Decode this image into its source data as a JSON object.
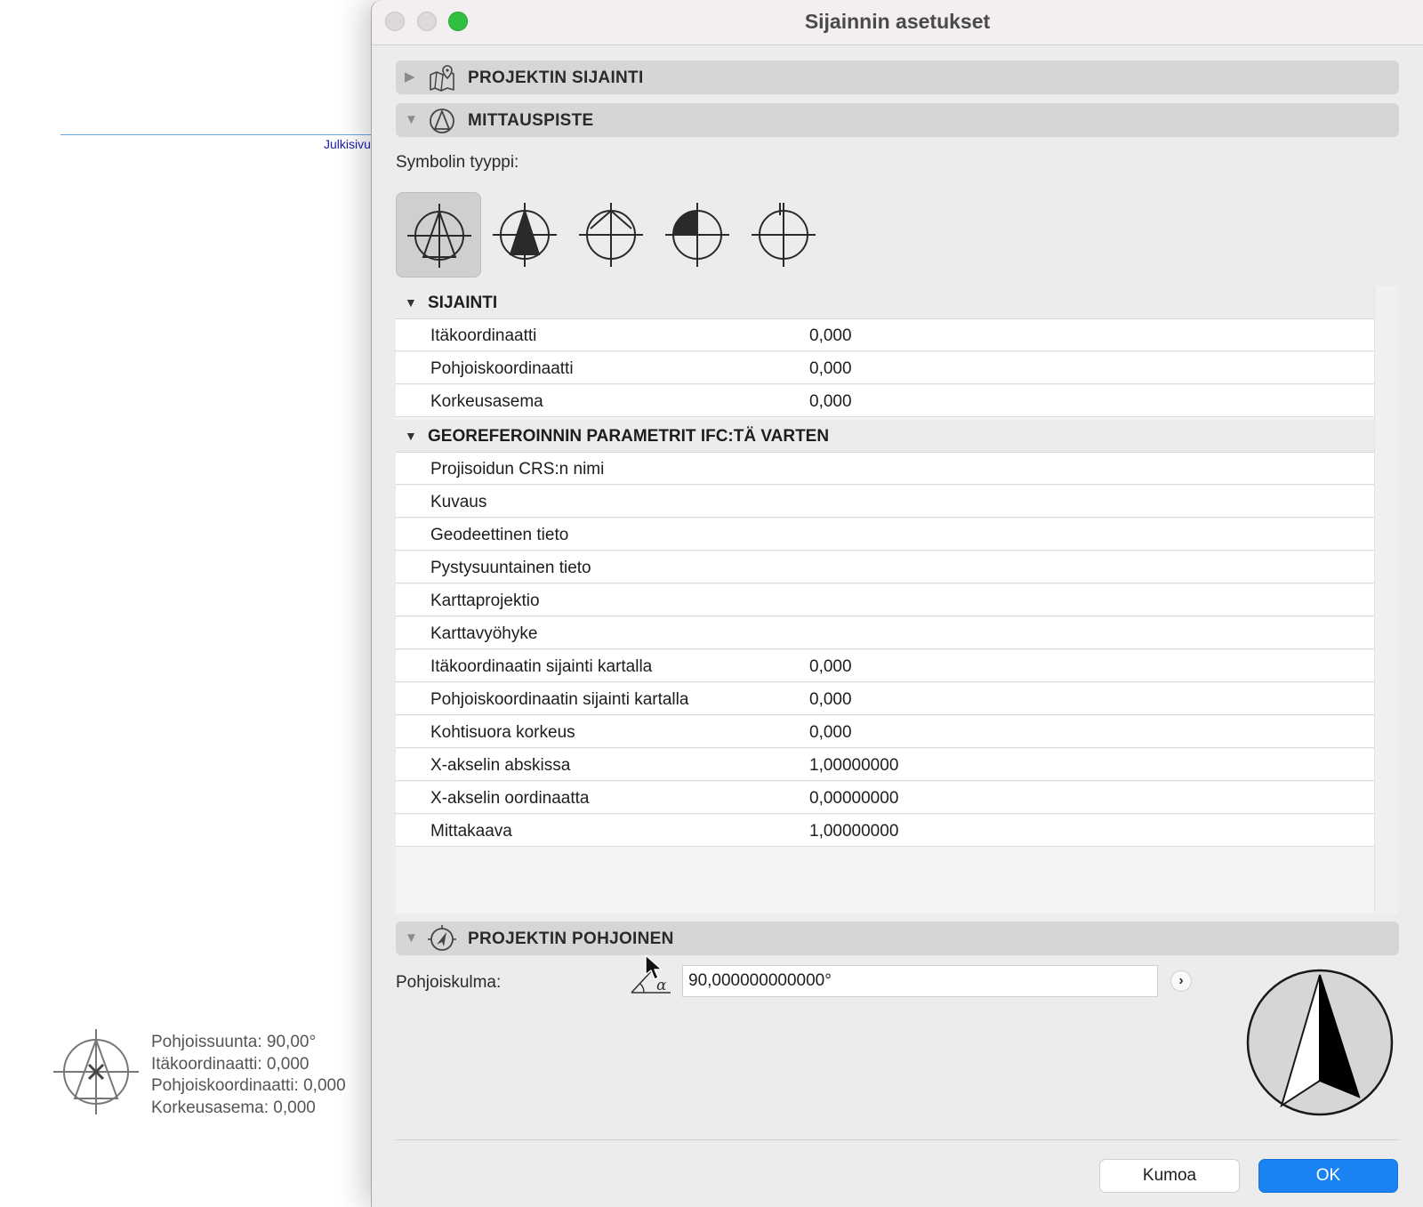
{
  "background": {
    "elevation_label": "Julkisivu",
    "survey_info": [
      "Pohjoissuunta: 90,00°",
      "Itäkoordinaatti: 0,000",
      "Pohjoiskoordinaatti: 0,000",
      "Korkeusasema: 0,000"
    ]
  },
  "dialog": {
    "title": "Sijainnin asetukset",
    "sections": {
      "project_location": {
        "label": "PROJEKTIN SIJAINTI",
        "expanded": false
      },
      "survey_point": {
        "label": "MITTAUSPISTE",
        "expanded": true
      },
      "project_north": {
        "label": "PROJEKTIN POHJOINEN",
        "expanded": true
      }
    },
    "symbol_type_label": "Symbolin tyyppi:",
    "symbol_types": [
      "symbol-type-1",
      "symbol-type-2",
      "symbol-type-3",
      "symbol-type-4",
      "symbol-type-5"
    ],
    "symbol_selected_index": 0,
    "location_group": {
      "label": "SIJAINTI",
      "rows": [
        {
          "key": "Itäkoordinaatti",
          "value": "0,000"
        },
        {
          "key": "Pohjoiskoordinaatti",
          "value": "0,000"
        },
        {
          "key": "Korkeusasema",
          "value": "0,000"
        }
      ]
    },
    "ifc_group": {
      "label": "GEOREFEROINNIN PARAMETRIT IFC:TÄ VARTEN",
      "rows": [
        {
          "key": "Projisoidun CRS:n nimi",
          "value": ""
        },
        {
          "key": "Kuvaus",
          "value": ""
        },
        {
          "key": "Geodeettinen tieto",
          "value": ""
        },
        {
          "key": "Pystysuuntainen tieto",
          "value": ""
        },
        {
          "key": "Karttaprojektio",
          "value": ""
        },
        {
          "key": "Karttavyöhyke",
          "value": ""
        },
        {
          "key": "Itäkoordinaatin sijainti kartalla",
          "value": "0,000"
        },
        {
          "key": "Pohjoiskoordinaatin sijainti kartalla",
          "value": "0,000"
        },
        {
          "key": "Kohtisuora korkeus",
          "value": "0,000"
        },
        {
          "key": "X-akselin abskissa",
          "value": "1,00000000"
        },
        {
          "key": "X-akselin oordinaatta",
          "value": "0,00000000"
        },
        {
          "key": "Mittakaava",
          "value": "1,00000000"
        }
      ]
    },
    "north_angle_label": "Pohjoiskulma:",
    "north_angle_value": "90,000000000000°",
    "buttons": {
      "cancel": "Kumoa",
      "ok": "OK"
    },
    "colors": {
      "accent": "#1a82f3",
      "zoom_button": "#2fc042"
    }
  }
}
